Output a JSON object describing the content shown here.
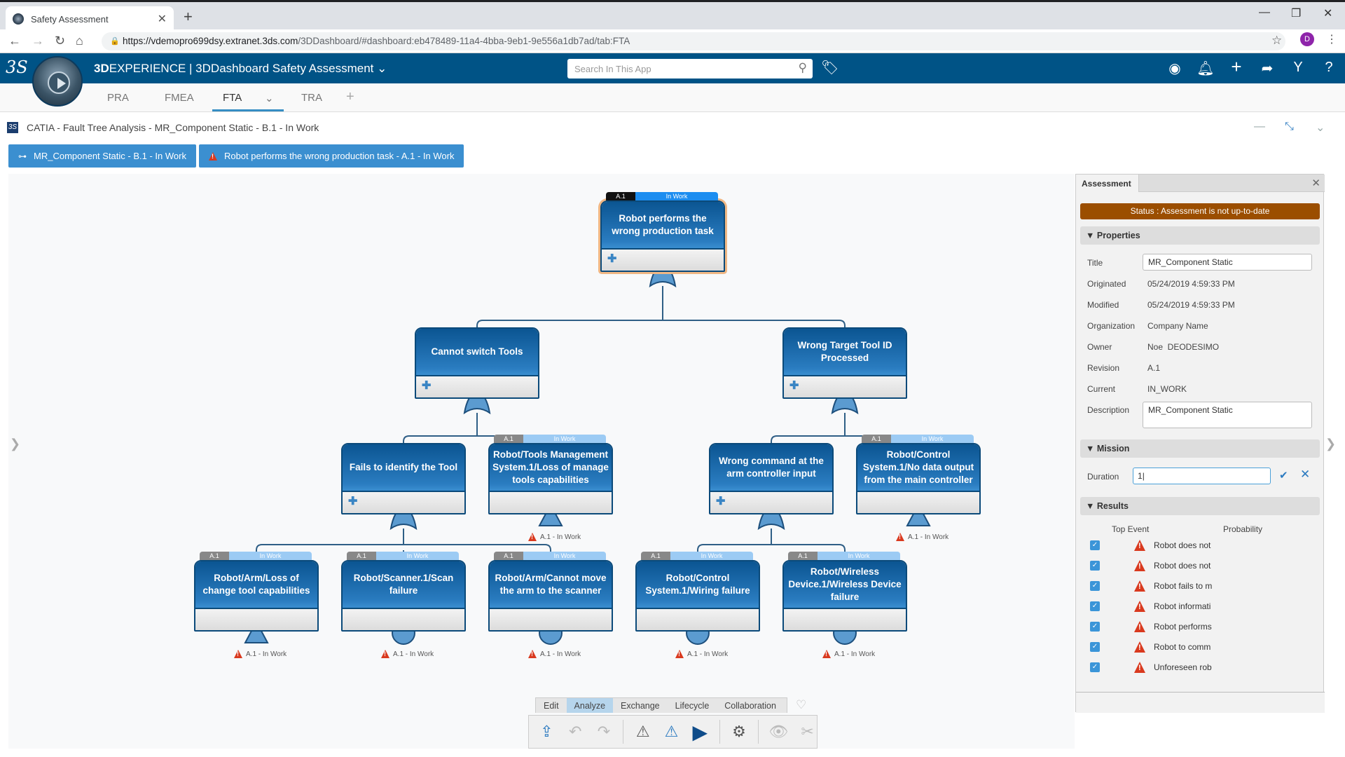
{
  "browser": {
    "tab_title": "Safety Assessment",
    "new_tab": "+",
    "url_host": "https://vdemopro699dsy.extranet.3ds.com",
    "url_path": "/3DDashboard/#dashboard:eb478489-11a4-4bba-9eb1-9e556a1db7ad/tab:FTA",
    "profile_initial": "D",
    "profile_color": "#8e24aa"
  },
  "topbar": {
    "brand_bold": "3D",
    "brand_rest": "EXPERIENCE | 3DDashboard  Safety Assessment",
    "search_placeholder": "Search In This App",
    "bar_color": "#005386"
  },
  "app_tabs": [
    {
      "label": "PRA"
    },
    {
      "label": "FMEA"
    },
    {
      "label": "FTA",
      "active": true
    },
    {
      "label": "TRA"
    }
  ],
  "widget": {
    "title": "CATIA - Fault Tree Analysis - MR_Component Static - B.1 - In Work",
    "breadcrumbs": [
      {
        "label": "MR_Component Static - B.1 - In Work",
        "icon": "structure-icon"
      },
      {
        "label": "Robot performs the wrong production task - A.1 - In Work",
        "icon": "warning-icon"
      }
    ]
  },
  "fault_tree": {
    "nodes": [
      {
        "id": "top",
        "label": "Robot performs the wrong production task",
        "revision": "A.1",
        "state": "In Work",
        "gate": "or",
        "expandable": true,
        "selected": true
      },
      {
        "id": "n1",
        "label": "Cannot switch Tools",
        "gate": "or",
        "expandable": true
      },
      {
        "id": "n2",
        "label": "Wrong Target Tool ID Processed",
        "gate": "or",
        "expandable": true
      },
      {
        "id": "n11",
        "label": "Fails to identify the Tool",
        "gate": "or",
        "expandable": true
      },
      {
        "id": "n12",
        "label": "Robot/Tools Management System.1/Loss of manage tools capabilities",
        "revision": "A.1",
        "state": "In Work",
        "gate": "transfer",
        "status": "A.1 - In Work"
      },
      {
        "id": "n21",
        "label": "Wrong command at the arm controller input",
        "gate": "or",
        "expandable": true
      },
      {
        "id": "n22",
        "label": "Robot/Control System.1/No data output from the main controller",
        "revision": "A.1",
        "state": "In Work",
        "gate": "transfer",
        "status": "A.1 - In Work"
      },
      {
        "id": "n111",
        "label": "Robot/Arm/Loss of change tool capabilities",
        "revision": "A.1",
        "state": "In Work",
        "gate": "transfer",
        "status": "A.1 - In Work"
      },
      {
        "id": "n112",
        "label": "Robot/Scanner.1/Scan failure",
        "revision": "A.1",
        "state": "In Work",
        "gate": "basic",
        "status": "A.1 - In Work"
      },
      {
        "id": "n113",
        "label": "Robot/Arm/Cannot move the arm to the scanner",
        "revision": "A.1",
        "state": "In Work",
        "gate": "basic",
        "status": "A.1 - In Work"
      },
      {
        "id": "n211",
        "label": "Robot/Control System.1/Wiring failure",
        "revision": "A.1",
        "state": "In Work",
        "gate": "basic",
        "status": "A.1 - In Work"
      },
      {
        "id": "n212",
        "label": "Robot/Wireless Device.1/Wireless Device failure",
        "revision": "A.1",
        "state": "In Work",
        "gate": "basic",
        "status": "A.1 - In Work"
      }
    ]
  },
  "panel": {
    "tab": "Assessment",
    "status": "Status : Assessment is not up-to-date",
    "status_color": "#9b4e00",
    "properties_header": "Properties",
    "properties": {
      "title_label": "Title",
      "title_value": "MR_Component Static",
      "originated_label": "Originated",
      "originated_value": "05/24/2019 4:59:33 PM",
      "modified_label": "Modified",
      "modified_value": "05/24/2019 4:59:33 PM",
      "organization_label": "Organization",
      "organization_value": "Company Name",
      "owner_label": "Owner",
      "owner_value": "Noe  DEODESIMO",
      "revision_label": "Revision",
      "revision_value": "A.1",
      "current_label": "Current",
      "current_value": "IN_WORK",
      "description_label": "Description",
      "description_value": "MR_Component Static"
    },
    "mission_header": "Mission",
    "duration_label": "Duration",
    "duration_value": "1",
    "results_header": "Results",
    "results_columns": [
      "Top Event",
      "Probability"
    ],
    "results": [
      {
        "checked": true,
        "event": "Robot does not",
        "probability": ""
      },
      {
        "checked": true,
        "event": "Robot does not",
        "probability": ""
      },
      {
        "checked": true,
        "event": "Robot fails to m",
        "probability": ""
      },
      {
        "checked": true,
        "event": "Robot informati",
        "probability": ""
      },
      {
        "checked": true,
        "event": "Robot performs",
        "probability": ""
      },
      {
        "checked": true,
        "event": "Robot to comm",
        "probability": ""
      },
      {
        "checked": true,
        "event": "Unforeseen rob",
        "probability": ""
      }
    ]
  },
  "toolbar": {
    "tabs": [
      "Edit",
      "Analyze",
      "Exchange",
      "Lifecycle",
      "Collaboration"
    ],
    "active_tab": "Analyze",
    "icons": [
      "export-icon",
      "undo-icon",
      "redo-icon",
      "add-risk-icon",
      "open-risk-icon",
      "run-analysis-icon",
      "settings-mapping-icon",
      "toggle-visibility-icon",
      "cut-tree-icon"
    ]
  }
}
